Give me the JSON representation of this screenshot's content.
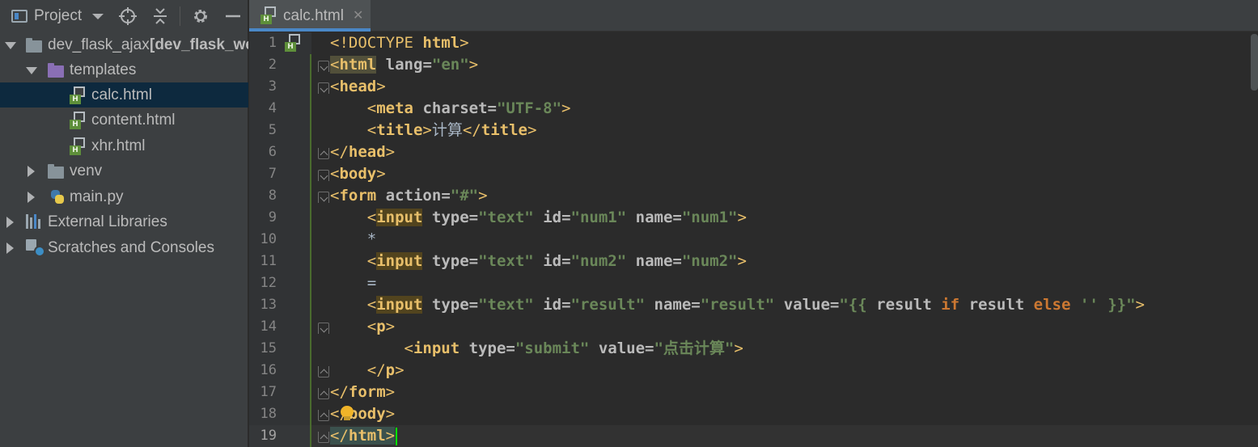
{
  "project_panel": {
    "title": "Project",
    "tree": [
      {
        "label": "dev_flask_ajax",
        "suffix": "[dev_flask_we",
        "icon": "folder-icon",
        "arrow": "down"
      },
      {
        "label": "templates",
        "icon": "folder-icon",
        "arrow": "down"
      },
      {
        "label": "calc.html",
        "icon": "html-file-icon",
        "selected": true
      },
      {
        "label": "content.html",
        "icon": "html-file-icon"
      },
      {
        "label": "xhr.html",
        "icon": "html-file-icon"
      },
      {
        "label": "venv",
        "icon": "folder-icon",
        "arrow": "right"
      },
      {
        "label": "main.py",
        "icon": "python-file-icon",
        "arrow": "right"
      },
      {
        "label": "External Libraries",
        "icon": "library-icon",
        "arrow": "right"
      },
      {
        "label": "Scratches and Consoles",
        "icon": "scratches-icon",
        "arrow": "right"
      }
    ]
  },
  "editor": {
    "tab_label": "calc.html",
    "tab_close": "✕",
    "line_numbers": [
      "1",
      "2",
      "3",
      "4",
      "5",
      "6",
      "7",
      "8",
      "9",
      "10",
      "11",
      "12",
      "13",
      "14",
      "15",
      "16",
      "17",
      "18",
      "19"
    ],
    "current_line": "19",
    "code": {
      "l1_doctype": "<!DOCTYPE",
      "l1_html": "html",
      "l2_html": "html",
      "l2_lang": "lang",
      "l2_lang_val": "\"en\"",
      "head": "head",
      "meta": "meta",
      "charset": "charset",
      "charset_val": "\"UTF-8\"",
      "title": "title",
      "title_text": "计算",
      "body": "body",
      "form": "form",
      "action": "action",
      "action_val": "\"#\"",
      "input": "input",
      "type": "type",
      "text_val": "\"text\"",
      "id": "id",
      "name": "name",
      "num1": "\"num1\"",
      "num2": "\"num2\"",
      "star": "*",
      "eq": "=",
      "result": "\"result\"",
      "value": "value",
      "jinja_open": "\"{{",
      "jinja_result": "result",
      "jinja_if": "if",
      "jinja_else": "else",
      "jinja_empty": "''",
      "jinja_close": "}}\"",
      "p": "p",
      "submit_val": "\"submit\"",
      "button_val": "\"点击计算\""
    }
  },
  "colors": {
    "tag": "#e8bf6a",
    "attr": "#bababa",
    "value": "#6a8759",
    "keyword": "#cc7832",
    "selection": "#0d293e"
  }
}
